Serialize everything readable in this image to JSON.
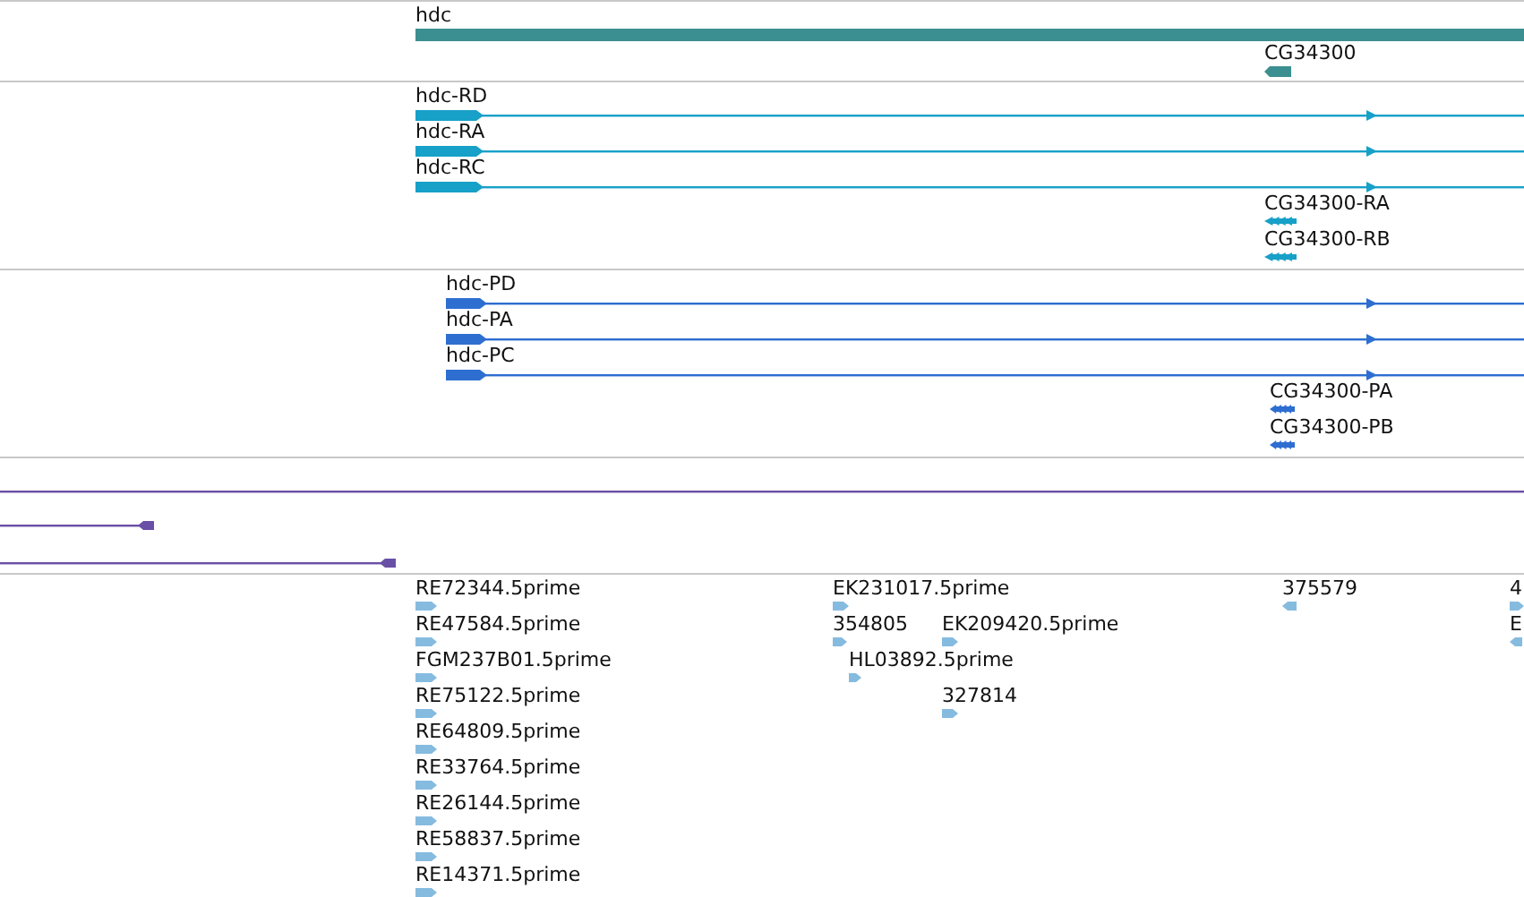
{
  "tracks": [
    {
      "kind": "gene",
      "features": [
        {
          "label": "hdc",
          "kind": "forward"
        },
        {
          "label": "CG34300",
          "kind": "reverse"
        }
      ]
    },
    {
      "kind": "transcript",
      "features": [
        {
          "label": "hdc-RD",
          "kind": "forward"
        },
        {
          "label": "hdc-RA",
          "kind": "forward"
        },
        {
          "label": "hdc-RC",
          "kind": "forward"
        },
        {
          "label": "CG34300-RA",
          "kind": "reverse"
        },
        {
          "label": "CG34300-RB",
          "kind": "reverse"
        }
      ]
    },
    {
      "kind": "protein",
      "features": [
        {
          "label": "hdc-PD",
          "kind": "forward"
        },
        {
          "label": "hdc-PA",
          "kind": "forward"
        },
        {
          "label": "hdc-PC",
          "kind": "forward"
        },
        {
          "label": "CG34300-PA",
          "kind": "reverse"
        },
        {
          "label": "CG34300-PB",
          "kind": "reverse"
        }
      ]
    },
    {
      "kind": "line",
      "features": [
        {
          "kind": "plain"
        },
        {
          "kind": "reverse"
        },
        {
          "kind": "reverse"
        }
      ]
    },
    {
      "kind": "est",
      "features": [
        {
          "label": "RE72344.5prime",
          "kind": "forward"
        },
        {
          "label": "RE47584.5prime",
          "kind": "forward"
        },
        {
          "label": "FGM237B01.5prime",
          "kind": "forward"
        },
        {
          "label": "RE75122.5prime",
          "kind": "forward"
        },
        {
          "label": "RE64809.5prime",
          "kind": "forward"
        },
        {
          "label": "RE33764.5prime",
          "kind": "forward"
        },
        {
          "label": "RE26144.5prime",
          "kind": "forward"
        },
        {
          "label": "RE58837.5prime",
          "kind": "forward"
        },
        {
          "label": "RE14371.5prime",
          "kind": "forward"
        },
        {
          "label": "EK231017.5prime",
          "kind": "forward"
        },
        {
          "label": "354805",
          "kind": "forward"
        },
        {
          "label": "EK209420.5prime",
          "kind": "forward"
        },
        {
          "label": "HL03892.5prime",
          "kind": "forward"
        },
        {
          "label": "327814",
          "kind": "forward"
        },
        {
          "label": "375579",
          "kind": "reverse"
        },
        {
          "label": "4",
          "kind": "forward"
        },
        {
          "label": "E",
          "kind": "reverse"
        }
      ]
    }
  ]
}
